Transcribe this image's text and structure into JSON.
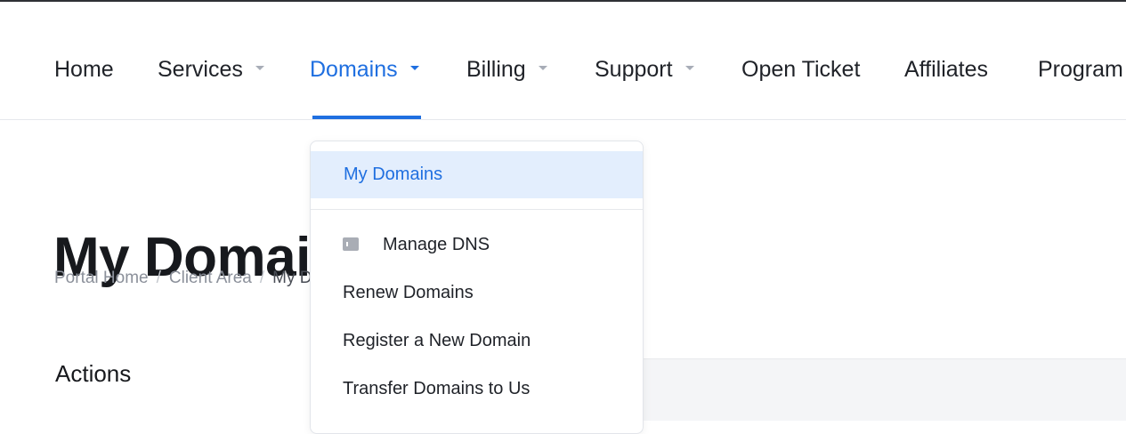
{
  "nav": {
    "items": [
      {
        "label": "Home",
        "has_caret": false
      },
      {
        "label": "Services",
        "has_caret": true
      },
      {
        "label": "Domains",
        "has_caret": true,
        "active": true
      },
      {
        "label": "Billing",
        "has_caret": true
      },
      {
        "label": "Support",
        "has_caret": true
      },
      {
        "label": "Open Ticket",
        "has_caret": false
      },
      {
        "label": "Affiliates",
        "has_caret": false
      },
      {
        "label": "Program",
        "has_caret": false
      }
    ],
    "active_color": "#1f6fe0"
  },
  "page": {
    "title": "My Domains",
    "breadcrumb": [
      "Portal Home",
      "Client Area",
      "My Domains"
    ],
    "actions_heading": "Actions"
  },
  "dropdown": {
    "items": [
      {
        "label": "My Domains",
        "selected": true
      },
      {
        "label": "Manage DNS",
        "icon": "dns-icon"
      },
      {
        "label": "Renew Domains"
      },
      {
        "label": "Register a New Domain"
      },
      {
        "label": "Transfer Domains to Us"
      }
    ]
  }
}
